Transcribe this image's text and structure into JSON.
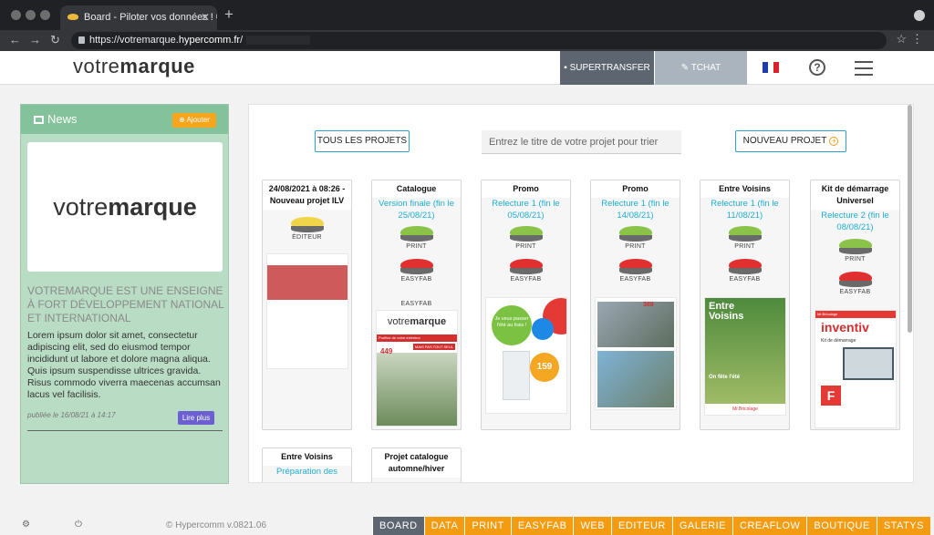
{
  "browser": {
    "tab_title": "Board - Piloter vos données ! ©",
    "url_prefix": "https://votremarque.",
    "url_host": "hypercomm.fr",
    "url_suffix": "/"
  },
  "header": {
    "brand_light": "votre",
    "brand_bold": "marque",
    "supertransfer": "SUPERTRANSFER",
    "tchat": "TCHAT",
    "help_glyph": "?",
    "flag_colors": [
      "#1f3da8",
      "#ffffff",
      "#d8232a"
    ]
  },
  "news": {
    "title": "News",
    "add_label": "⊕ Ajouter",
    "logo_light": "votre",
    "logo_bold": "marque",
    "subtitle": "VOTREMARQUE EST UNE ENSEIGNE À FORT DÉVELOPPEMENT NATIONAL ET INTERNATIONAL",
    "body": "Lorem ipsum dolor sit amet, consectetur adipiscing elit, sed do eiusmod tempor incididunt ut labore et dolore magna aliqua. Quis ipsum suspendisse ultrices gravida. Risus commodo viverra maecenas accumsan lacus vel facilisis.",
    "date": "publiée le 16/08/21 à 14:17",
    "more_label": "Lire plus"
  },
  "toolbar": {
    "all_projects": "TOUS LES PROJETS",
    "search_placeholder": "Entrez le titre de votre projet pour trier",
    "new_project": "NOUVEAU PROJET",
    "new_plus": "+"
  },
  "cards": [
    {
      "title": "24/08/2021 à 08:26 - Nouveau projet ILV",
      "status": "",
      "tools": [
        "ÉDITEUR"
      ]
    },
    {
      "title": "Catalogue",
      "status": "Version finale (fin le 25/08/21)",
      "tools": [
        "PRINT",
        "EASYFAB"
      ],
      "extra": "EASYFAB",
      "thumb_brand_light": "votre",
      "thumb_brand_bold": "marque",
      "thumb_tagline": "Profitez de votre extérieur",
      "thumb_badge": "MAIS PAS TOUT SEUL",
      "thumb_price": "449"
    },
    {
      "title": "Promo",
      "status": "Relecture 1 (fin le 05/08/21)",
      "tools": [
        "PRINT",
        "EASYFAB"
      ],
      "thumb_bubble": "Je veux passer l'été au frais !",
      "thumb_price": "159"
    },
    {
      "title": "Promo",
      "status": "Relecture 1 (fin le 14/08/21)",
      "tools": [
        "PRINT",
        "EASYFAB"
      ],
      "thumb_price": "389"
    },
    {
      "title": "Entre Voisins",
      "status": "Relecture 1 (fin le 11/08/21)",
      "tools": [
        "PRINT",
        "EASYFAB"
      ],
      "thumb_title": "Entre Voisins",
      "thumb_line": "On fête l'été",
      "thumb_footer": "Mr.Bricolage"
    },
    {
      "title": "Kit de démarrage Universel",
      "status": "Relecture 2 (fin le 08/08/21)",
      "tools": [
        "PRINT",
        "EASYFAB"
      ],
      "thumb_header": "Mr.Bricolage",
      "thumb_title": "inventiv",
      "thumb_kit": "Kit de démarrage",
      "thumb_letter": "F"
    },
    {
      "title": "Entre Voisins",
      "status": "Préparation des"
    },
    {
      "title": "Projet catalogue automne/hiver",
      "status": ""
    }
  ],
  "footer": {
    "settings_icon": "⚙",
    "power_icon": "⏻",
    "copyright": "© Hypercomm v.0821.06",
    "nav": [
      {
        "label": "BOARD",
        "color": "#5d6670"
      },
      {
        "label": "DATA",
        "color": "#f39c12"
      },
      {
        "label": "PRINT",
        "color": "#f39c12"
      },
      {
        "label": "EASYFAB",
        "color": "#f39c12"
      },
      {
        "label": "WEB",
        "color": "#f39c12"
      },
      {
        "label": "EDITEUR",
        "color": "#f39c12"
      },
      {
        "label": "GALERIE",
        "color": "#f39c12"
      },
      {
        "label": "CREAFLOW",
        "color": "#f39c12"
      },
      {
        "label": "BOUTIQUE",
        "color": "#f39c12"
      },
      {
        "label": "STATYS",
        "color": "#f39c12"
      }
    ]
  }
}
